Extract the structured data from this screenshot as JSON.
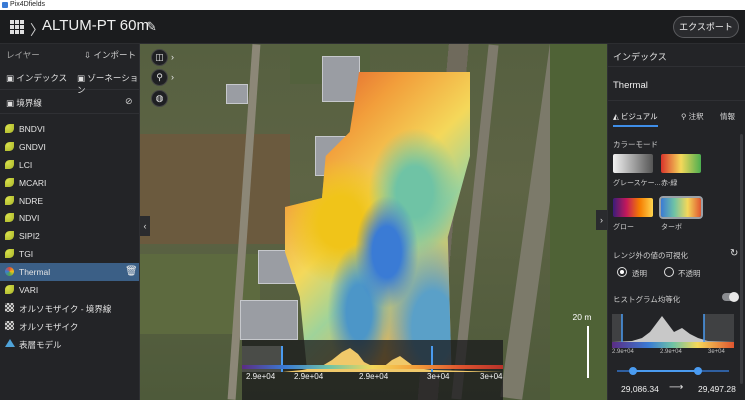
{
  "window": {
    "title": "Pix4Dfields"
  },
  "header": {
    "project_title": "ALTUM-PT 60m",
    "export_label": "エクスポート"
  },
  "sidebar": {
    "layers_label": "レイヤー",
    "import_label": "インポート",
    "index_label": "インデックス",
    "zonation_label": "ゾーネーション",
    "boundary_label": "境界線",
    "items": [
      {
        "label": "BNDVI",
        "icon": "leaf-icon"
      },
      {
        "label": "GNDVI",
        "icon": "leaf-icon"
      },
      {
        "label": "LCI",
        "icon": "leaf-icon"
      },
      {
        "label": "MCARI",
        "icon": "leaf-icon"
      },
      {
        "label": "NDRE",
        "icon": "leaf-icon"
      },
      {
        "label": "NDVI",
        "icon": "leaf-icon"
      },
      {
        "label": "SIPI2",
        "icon": "leaf-icon"
      },
      {
        "label": "TGI",
        "icon": "leaf-icon"
      },
      {
        "label": "Thermal",
        "icon": "thermal-icon",
        "active": true
      },
      {
        "label": "VARI",
        "icon": "leaf-icon"
      },
      {
        "label": "オルソモザイク - 境界線",
        "icon": "orthomosaic-icon"
      },
      {
        "label": "オルソモザイク",
        "icon": "orthomosaic-icon"
      },
      {
        "label": "表層モデル",
        "icon": "elevation-model-icon"
      }
    ]
  },
  "map": {
    "scale_label": "20 m",
    "histogram_ticks": [
      "2.9e+04",
      "2.9e+04",
      "2.9e+04",
      "3e+04",
      "3e+04"
    ]
  },
  "right_panel": {
    "title": "インデックス",
    "layer_name": "Thermal",
    "tabs": [
      "ビジュアル",
      "注釈",
      "情報"
    ],
    "color_mode_label": "カラーモード",
    "color_modes": [
      {
        "label": "グレースケー...",
        "colors": [
          "#f2f2f2",
          "#555555"
        ]
      },
      {
        "label": "赤-緑",
        "colors": [
          "#d9342b",
          "#f4d85a",
          "#4caf50"
        ]
      },
      {
        "label": "グロー",
        "colors": [
          "#3a1d7a",
          "#c2185b",
          "#f57c00",
          "#ffd54f"
        ]
      },
      {
        "label": "ターボ",
        "colors": [
          "#3a7bd5",
          "#6fc3a5",
          "#f4d85a",
          "#e0552f"
        ],
        "selected": true
      }
    ],
    "out_of_range_label": "レンジ外の値の可視化",
    "transparent_label": "透明",
    "opaque_label": "不透明",
    "hist_eq_label": "ヒストグラム均等化",
    "hist_ticks": [
      "2.9e+04",
      "2.9e+04",
      "3e+04"
    ],
    "range_min": "29,086.34",
    "range_max": "29,497.28",
    "accent_color": "#3f8ee8"
  }
}
